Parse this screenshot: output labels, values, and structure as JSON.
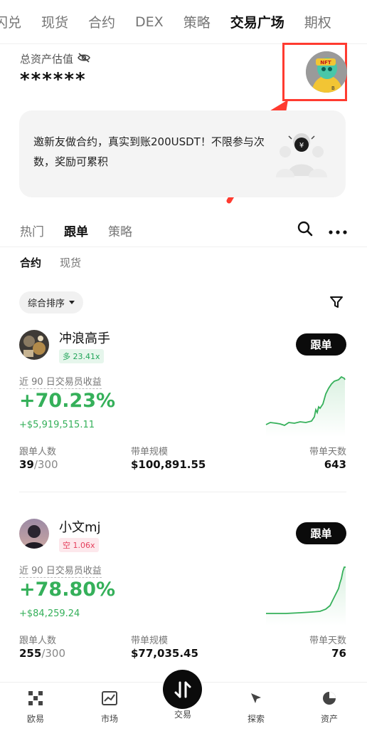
{
  "topnav": {
    "tabs": [
      "闪兑",
      "现货",
      "合约",
      "DEX",
      "策略",
      "交易广场",
      "期权"
    ],
    "active_index": 5
  },
  "asset": {
    "label": "总资产估值",
    "value": "******"
  },
  "avatar": {
    "badge": "NFT"
  },
  "banner": {
    "text": "邀新友做合约，真实到账200USDT！不限参与次数，奖励可累积"
  },
  "subtabs": {
    "items": [
      "热门",
      "跟单",
      "策略"
    ],
    "active_index": 1
  },
  "category": {
    "items": [
      "合约",
      "现货"
    ],
    "active_index": 0
  },
  "sort": {
    "label": "综合排序"
  },
  "traders": [
    {
      "name": "冲浪高手",
      "leverage": "多 23.41x",
      "leverage_side": "long",
      "follow_label": "跟单",
      "profit_label": "近 90 日交易员收益",
      "profit_pct": "+70.23%",
      "profit_amount": "+$5,919,515.11",
      "followers_label": "跟单人数",
      "followers": "39",
      "followers_max": "/300",
      "scale_label": "带单规模",
      "scale": "$100,891.55",
      "days_label": "带单天数",
      "days": "643"
    },
    {
      "name": "小文mj",
      "leverage": "空 1.06x",
      "leverage_side": "short",
      "follow_label": "跟单",
      "profit_label": "近 90 日交易员收益",
      "profit_pct": "+78.80%",
      "profit_amount": "+$84,259.24",
      "followers_label": "跟单人数",
      "followers": "255",
      "followers_max": "/300",
      "scale_label": "带单规模",
      "scale": "$77,035.45",
      "days_label": "带单天数",
      "days": "76"
    }
  ],
  "bottombar": {
    "items": [
      "欧易",
      "市场",
      "交易",
      "探索",
      "资产"
    ],
    "active_index": 2
  },
  "colors": {
    "positive": "#35b05a",
    "highlight_box": "#ff3b30",
    "primary_button": "#0b0b0b"
  }
}
